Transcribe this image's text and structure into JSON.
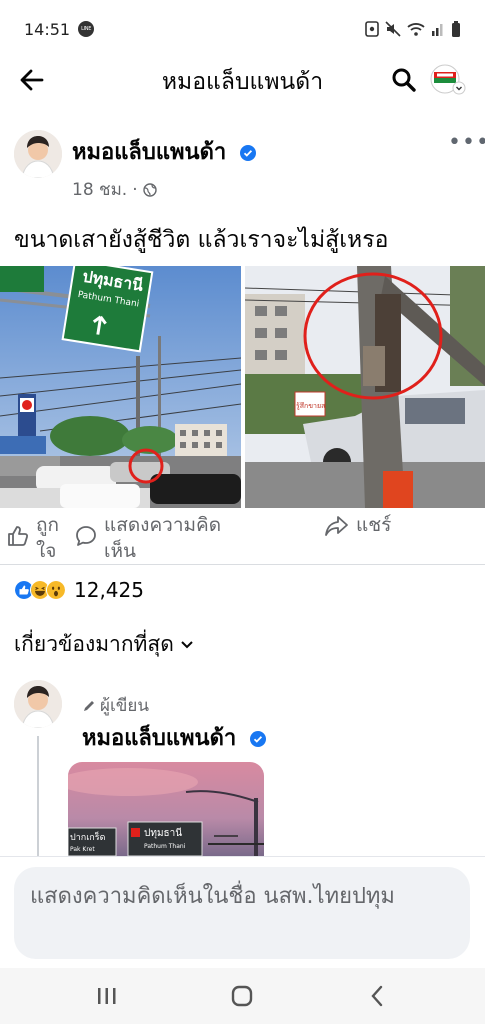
{
  "status": {
    "time": "14:51",
    "app_badge": "LINE"
  },
  "header": {
    "title": "หมอแล็บแพนด้า"
  },
  "post": {
    "author": "หมอแล็บแพนด้า",
    "time_ago": "18 ชม.",
    "separator": "·",
    "text": "ขนาดเสายังสู้ชีวิต แล้วเราจะไม่สู้เหรอ",
    "photo_left": {
      "sign_line1": "ปทุมธานี",
      "sign_line2": "Pathum Thani"
    },
    "photo_right": {
      "sign_text": "รู้สึกขายส"
    }
  },
  "actions": {
    "like_line1": "ถูก",
    "like_line2": "ใจ",
    "comment_line1": "แสดงความคิด",
    "comment_line2": "เห็น",
    "share": "แชร์"
  },
  "reactions": {
    "count": "12,425",
    "types": [
      "like-icon",
      "laugh-icon",
      "wow-icon"
    ],
    "colors": {
      "like": "#1877f2",
      "laugh": "#f7b928",
      "wow": "#f7b928"
    }
  },
  "sort": {
    "label": "เกี่ยวข้องมากที่สุด"
  },
  "comment": {
    "author_tag": "ผู้เขียน",
    "author": "หมอแล็บแพนด้า",
    "photo": {
      "sign_left": "ปากเกร็ด",
      "sign_left_en": "Pak Kret",
      "sign_right": "ปทุมธานี",
      "sign_right_en": "Pathum Thani"
    }
  },
  "composer": {
    "placeholder": "แสดงความคิดเห็นในชื่อ นสพ.ไทยปทุม"
  },
  "colors": {
    "brand": "#1877f2",
    "secondary_text": "#65676b",
    "annotation_red": "#e0201b"
  }
}
